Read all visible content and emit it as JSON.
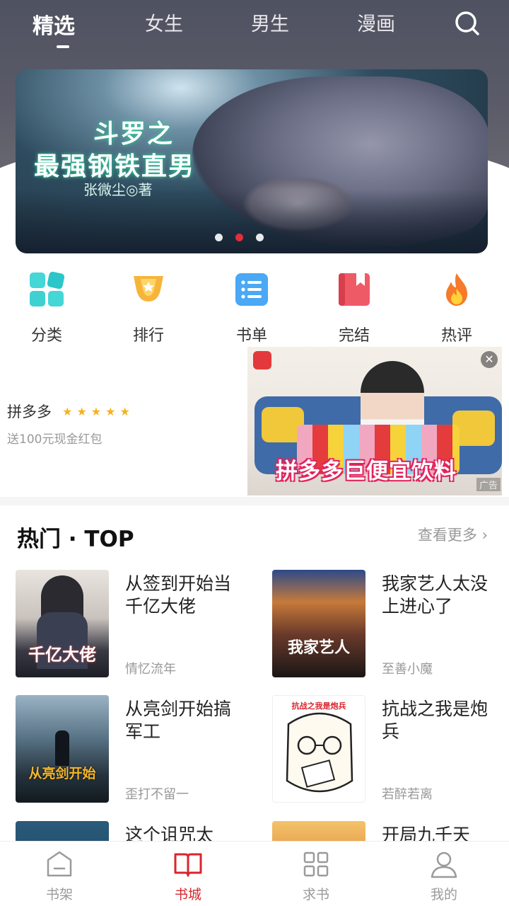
{
  "top_tabs": {
    "items": [
      "精选",
      "女生",
      "男生",
      "漫画"
    ],
    "active_index": 0
  },
  "banner": {
    "title_line1": "斗罗之",
    "title_line2": "最强钢铁直男",
    "author": "张微尘◎著",
    "slide_count": 3,
    "active_slide": 1
  },
  "quick_menu": {
    "items": [
      {
        "label": "分类",
        "icon": "category-icon"
      },
      {
        "label": "排行",
        "icon": "trophy-icon"
      },
      {
        "label": "书单",
        "icon": "list-icon"
      },
      {
        "label": "完结",
        "icon": "book-icon"
      },
      {
        "label": "热评",
        "icon": "flame-icon"
      }
    ]
  },
  "ad": {
    "name": "拼多多",
    "stars": "★★★★★",
    "rating": 5,
    "description": "送100元现金红包",
    "image_caption": "拼多多巨便宜饮料",
    "badge": "广告",
    "close": "✕"
  },
  "hot_section": {
    "title": "热门 · TOP",
    "see_more": "查看更多 ›",
    "books": [
      {
        "title": "从签到开始当千亿大佬",
        "author": "情忆流年",
        "cover_text": "千亿大佬"
      },
      {
        "title": "我家艺人太没上进心了",
        "author": "至善小魔",
        "cover_text": "我家艺人"
      },
      {
        "title": "从亮剑开始搞军工",
        "author": "歪打不留一",
        "cover_text": "从亮剑开始"
      },
      {
        "title": "抗战之我是炮兵",
        "author": "若醉若离",
        "cover_text": "抗战之我是炮兵"
      },
      {
        "title": "这个诅咒太",
        "author": "",
        "cover_text": ""
      },
      {
        "title": "开局九千天",
        "author": "",
        "cover_text": ""
      }
    ]
  },
  "bottom_nav": {
    "items": [
      {
        "label": "书架",
        "icon": "shelf-icon"
      },
      {
        "label": "书城",
        "icon": "open-book-icon"
      },
      {
        "label": "求书",
        "icon": "grid-icon"
      },
      {
        "label": "我的",
        "icon": "profile-icon"
      }
    ],
    "active_index": 1
  },
  "colors": {
    "accent": "#d9262f",
    "header": "#4f5261",
    "star": "#f7b21c",
    "muted_text": "#999999"
  }
}
